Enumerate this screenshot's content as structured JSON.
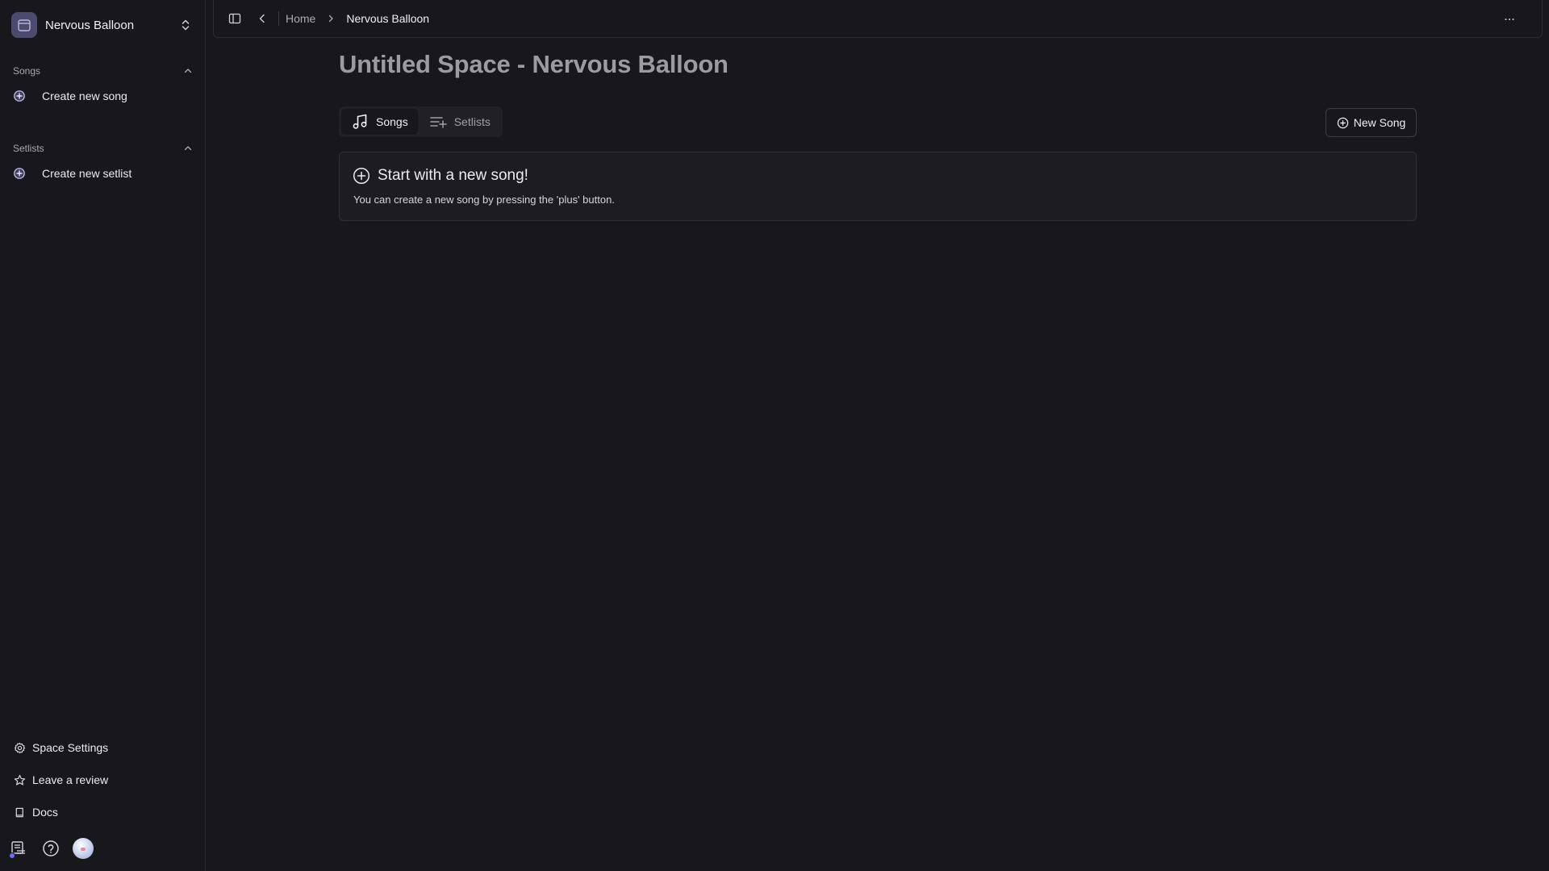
{
  "space": {
    "name": "Nervous Balloon"
  },
  "sidebar": {
    "sections": [
      {
        "title": "Songs",
        "item": "Create new song"
      },
      {
        "title": "Setlists",
        "item": "Create new setlist"
      }
    ],
    "footer": [
      {
        "label": "Space Settings",
        "icon": "gear-icon"
      },
      {
        "label": "Leave a review",
        "icon": "star-icon"
      },
      {
        "label": "Docs",
        "icon": "book-icon"
      }
    ],
    "bottom_icons": [
      "notes-list-icon",
      "help-icon",
      "user-avatar"
    ]
  },
  "topbar": {
    "breadcrumb": [
      "Home",
      "Nervous Balloon"
    ]
  },
  "main": {
    "title": "Untitled Space - Nervous Balloon",
    "tabs": [
      {
        "label": "Songs",
        "icon": "music-note-icon",
        "active": true
      },
      {
        "label": "Setlists",
        "icon": "list-plus-icon",
        "active": false
      }
    ],
    "new_song_label": "New Song",
    "empty_state": {
      "title": "Start with a new song!",
      "description": "You can create a new song by pressing the 'plus' button."
    }
  },
  "colors": {
    "background": "#18181c",
    "border": "#2c2c33",
    "avatar_bg": "#4c4a6e",
    "badge": "#6c6cff"
  }
}
